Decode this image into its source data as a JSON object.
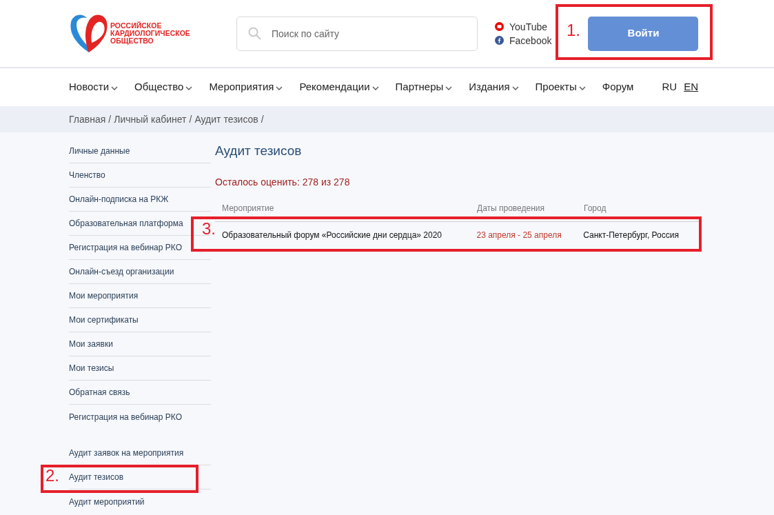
{
  "logo": {
    "lines": [
      "РОССИЙСКОЕ",
      "КАРДИОЛОГИЧЕСКОЕ",
      "ОБЩЕСТВО"
    ]
  },
  "search": {
    "placeholder": "Поиск по сайту"
  },
  "social_links": [
    {
      "kind": "youtube",
      "label": "YouTube"
    },
    {
      "kind": "facebook",
      "label": "Facebook"
    }
  ],
  "login_button": "Войти",
  "nav": [
    {
      "label": "Новости",
      "dropdown": true
    },
    {
      "label": "Общество",
      "dropdown": true
    },
    {
      "label": "Мероприятия",
      "dropdown": true
    },
    {
      "label": "Рекомендации",
      "dropdown": true
    },
    {
      "label": "Партнеры",
      "dropdown": true
    },
    {
      "label": "Издания",
      "dropdown": true
    },
    {
      "label": "Проекты",
      "dropdown": true
    },
    {
      "label": "Форум",
      "dropdown": false
    }
  ],
  "languages": [
    {
      "label": "RU",
      "selected": true
    },
    {
      "label": "EN",
      "selected": false
    }
  ],
  "breadcrumbs": [
    {
      "label": "Главная",
      "separator": "/"
    },
    {
      "label": "Личный кабинет",
      "separator": "/"
    },
    {
      "label": "Аудит тезисов",
      "separator": "/"
    }
  ],
  "sidebar": {
    "groups": [
      [
        "Личные данные",
        "Членство",
        "Онлайн-подписка на РКЖ",
        "Образовательная платформа",
        "Регистрация на вебинар РКО",
        "Онлайн-съезд организации",
        "Мои мероприятия",
        "Мои сертификаты",
        "Мои заявки",
        "Мои тезисы",
        "Обратная связь",
        "Регистрация на вебинар РКО"
      ],
      [
        "Аудит заявок на мероприятия",
        "Аудит тезисов",
        "Аудит мероприятий"
      ]
    ]
  },
  "page_title": "Аудит тезисов",
  "remaining": "Осталось оценить: 278 из 278",
  "table": {
    "columns": [
      "Мероприятие",
      "Даты проведения",
      "Город"
    ],
    "rows": [
      [
        "Образовательный форум «Российские дни сердца» 2020",
        "23 апреля - 25 апреля",
        "Санкт-Петербург, Россия"
      ]
    ]
  },
  "annotations": [
    {
      "label": "1.",
      "kind": "login"
    },
    {
      "label": "2.",
      "kind": "sidebar"
    },
    {
      "label": "3.",
      "kind": "row"
    }
  ]
}
